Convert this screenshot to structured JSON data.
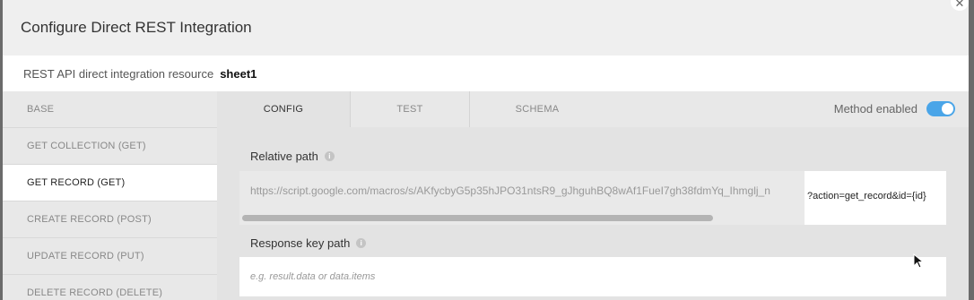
{
  "modal": {
    "title": "Configure Direct REST Integration",
    "close_icon": "close-icon"
  },
  "resource": {
    "label": "REST API direct integration resource",
    "name": "sheet1"
  },
  "sidebar": {
    "items": [
      {
        "label": "BASE",
        "active": false
      },
      {
        "label": "GET COLLECTION (GET)",
        "active": false
      },
      {
        "label": "GET RECORD (GET)",
        "active": true
      },
      {
        "label": "CREATE RECORD (POST)",
        "active": false
      },
      {
        "label": "UPDATE RECORD (PUT)",
        "active": false
      },
      {
        "label": "DELETE RECORD (DELETE)",
        "active": false
      }
    ]
  },
  "tabs": [
    {
      "label": "CONFIG",
      "active": true
    },
    {
      "label": "TEST",
      "active": false
    },
    {
      "label": "SCHEMA",
      "active": false
    }
  ],
  "method": {
    "label": "Method enabled",
    "enabled": true,
    "toggle_color": "#4aa5e8"
  },
  "relative_path": {
    "label": "Relative path",
    "value": "https://script.google.com/macros/s/AKfycbyG5p35hJPO31ntsR9_gJhguhBQ8wAf1FueI7gh38fdmYq_Ihmglj_n",
    "suffix": "?action=get_record&id={id}"
  },
  "response_key": {
    "label": "Response key path",
    "placeholder": "e.g. result.data or data.items"
  }
}
